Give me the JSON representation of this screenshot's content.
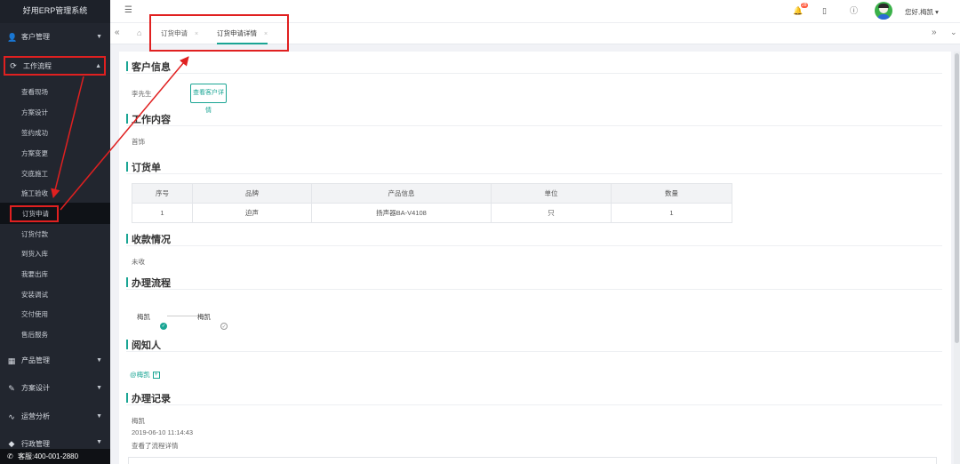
{
  "app": {
    "title": "好用ERP管理系统"
  },
  "sidebar": {
    "groups": [
      {
        "label": "客户管理",
        "icon": "user-icon"
      },
      {
        "label": "工作流程",
        "icon": "workflow-icon"
      },
      {
        "label": "产品管理",
        "icon": "grid-icon"
      },
      {
        "label": "方案设计",
        "icon": "edit-icon"
      },
      {
        "label": "运营分析",
        "icon": "chart-icon"
      },
      {
        "label": "行政管理",
        "icon": "admin-icon"
      }
    ],
    "items": [
      {
        "label": "查看现场"
      },
      {
        "label": "方案设计"
      },
      {
        "label": "签约成功"
      },
      {
        "label": "方案变更"
      },
      {
        "label": "交底施工"
      },
      {
        "label": "施工验收"
      },
      {
        "label": "订货申请"
      },
      {
        "label": "订货付款"
      },
      {
        "label": "到货入库"
      },
      {
        "label": "我要出库"
      },
      {
        "label": "安装调试"
      },
      {
        "label": "交付使用"
      },
      {
        "label": "售后服务"
      }
    ],
    "hotline": "客服:400-001-2880"
  },
  "topbar": {
    "notification_count": "28",
    "user_greeting": "您好,梅凯 ▾"
  },
  "tabs": [
    {
      "label": "订货申请"
    },
    {
      "label": "订货申请详情"
    }
  ],
  "sections": {
    "customer": {
      "title": "客户信息",
      "name": "李先生",
      "button": "查看客户详情"
    },
    "work": {
      "title": "工作内容",
      "text": "首饰"
    },
    "order": {
      "title": "订货单",
      "columns": [
        "序号",
        "品牌",
        "产品信息",
        "单位",
        "数量"
      ],
      "rows": [
        [
          "1",
          "迫声",
          "扬声器BA-V4108",
          "只",
          "1"
        ]
      ]
    },
    "payment": {
      "title": "收款情况",
      "text": "未收"
    },
    "process": {
      "title": "办理流程",
      "steps": [
        "梅凯",
        "梅凯"
      ]
    },
    "notify": {
      "title": "阅知人",
      "person": "@梅凯"
    },
    "records": {
      "title": "办理记录",
      "user": "梅凯",
      "time": "2019-06-10 11:14:43",
      "action": "查看了流程详情"
    }
  },
  "colors": {
    "accent": "#1aa594",
    "sidebar_bg": "#22262f",
    "highlight": "#e02020"
  }
}
